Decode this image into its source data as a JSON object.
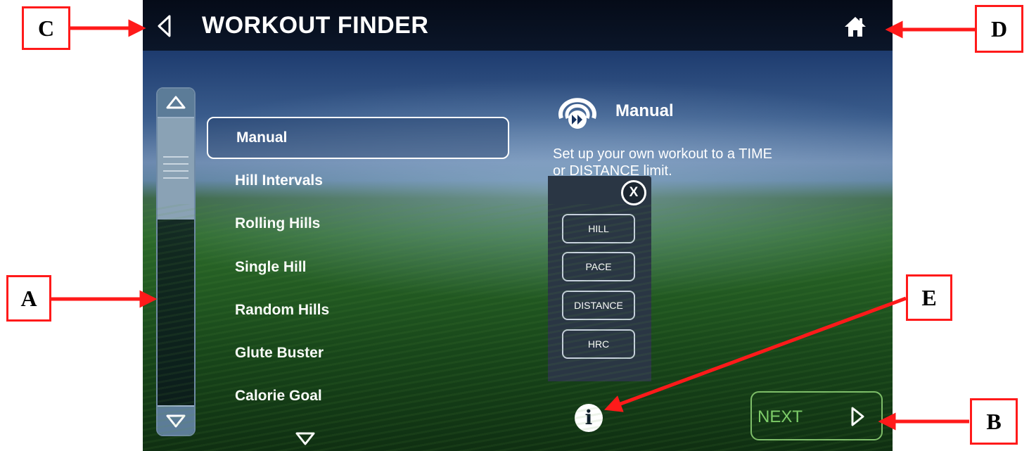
{
  "screen": {
    "title": "WORKOUT FINDER",
    "icons": {
      "back": "chevron-left-icon",
      "home": "home-icon",
      "info": "info-icon",
      "workout": "workout-type-icon"
    }
  },
  "workouts": {
    "items": [
      {
        "label": "Manual",
        "selected": true
      },
      {
        "label": "Hill Intervals"
      },
      {
        "label": "Rolling Hills"
      },
      {
        "label": "Single Hill"
      },
      {
        "label": "Random Hills"
      },
      {
        "label": "Glute Buster"
      },
      {
        "label": "Calorie Goal"
      }
    ]
  },
  "detail": {
    "title": "Manual",
    "description": "Set up your own workout to a TIME or DISTANCE limit."
  },
  "filter_popup": {
    "close_label": "X",
    "options": [
      "HILL",
      "PACE",
      "DISTANCE",
      "HRC"
    ]
  },
  "info_label": "i",
  "next_label": "NEXT",
  "callouts": [
    "A",
    "B",
    "C",
    "D",
    "E"
  ],
  "colors": {
    "callout": "#ff1a1a",
    "next_accent": "#7fcf6a",
    "topbar": "#0b1629"
  }
}
